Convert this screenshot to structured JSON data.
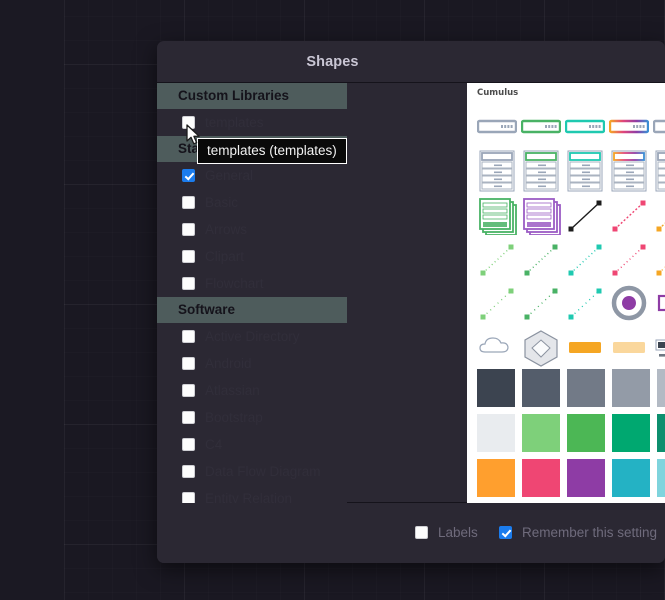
{
  "dialog": {
    "title": "Shapes"
  },
  "library_list": {
    "sections": [
      {
        "header": "Custom Libraries",
        "items": [
          {
            "label": "templates",
            "checked": false
          }
        ]
      },
      {
        "header": "Standard",
        "items": [
          {
            "label": "General",
            "checked": true
          },
          {
            "label": "Basic",
            "checked": false
          },
          {
            "label": "Arrows",
            "checked": false
          },
          {
            "label": "Clipart",
            "checked": false
          },
          {
            "label": "Flowchart",
            "checked": false
          }
        ]
      },
      {
        "header": "Software",
        "items": [
          {
            "label": "Active Directory",
            "checked": false
          },
          {
            "label": "Android",
            "checked": false
          },
          {
            "label": "Atlassian",
            "checked": false
          },
          {
            "label": "Bootstrap",
            "checked": false
          },
          {
            "label": "C4",
            "checked": false
          },
          {
            "label": "Data Flow Diagram",
            "checked": false
          },
          {
            "label": "Entity Relation",
            "checked": false
          }
        ]
      }
    ]
  },
  "tooltip": {
    "text": "templates (templates)"
  },
  "preview": {
    "title": "Cumulus",
    "swatch_rows": [
      [
        "#3c4450",
        "#545d6b",
        "#727a87",
        "#939ba7",
        "#b3bac4"
      ],
      [
        "#e9ecef",
        "#7ed07a",
        "#4cb755",
        "#00a870",
        "#0d8f6e"
      ],
      [
        "#ff9f2e",
        "#ef4673",
        "#8e3ca5",
        "#24b2c4",
        "#7fd4dd"
      ]
    ]
  },
  "footer": {
    "labels": {
      "label": "Labels",
      "checked": false
    },
    "remember": {
      "label": "Remember this setting",
      "checked": true
    }
  }
}
